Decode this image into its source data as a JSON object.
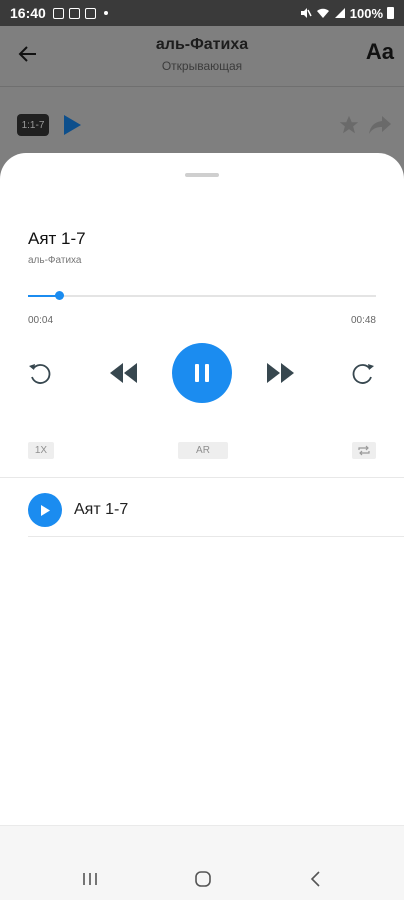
{
  "status_bar": {
    "time": "16:40",
    "battery": "100%"
  },
  "header": {
    "title": "аль-Фатиха",
    "subtitle": "Открывающая",
    "font_button_label": "Aa"
  },
  "verse": {
    "badge": "1:1-7"
  },
  "player": {
    "track_title": "Аят 1-7",
    "track_subtitle": "аль-Фатиха",
    "current_time": "00:04",
    "total_time": "00:48",
    "progress": 0.09,
    "speed_label": "1X",
    "language_label": "AR",
    "is_playing": true
  },
  "playlist": {
    "items": [
      {
        "label": "Аят 1-7"
      }
    ]
  },
  "colors": {
    "accent": "#1b8cf0",
    "control_dark": "#37474f",
    "sheet_background": "#ffffff"
  },
  "icons": {
    "back": "arrow-left-icon",
    "play": "play-icon",
    "star": "star-icon",
    "share": "share-icon",
    "rewind": "rewind-icon",
    "previous": "previous-icon",
    "pause": "pause-icon",
    "next": "next-icon",
    "forward": "forward-icon",
    "repeat": "repeat-icon"
  }
}
